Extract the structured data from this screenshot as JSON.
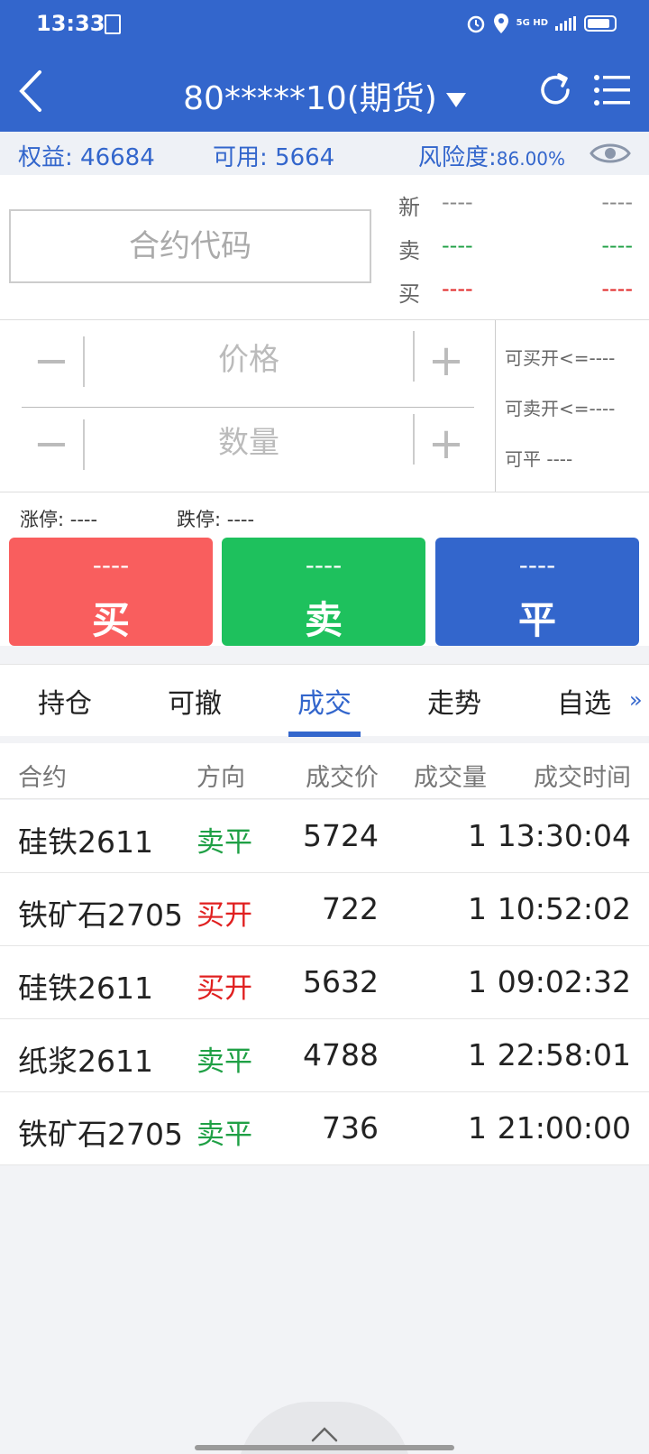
{
  "status_bar": {
    "time": "13:33",
    "network": "5G HD"
  },
  "nav": {
    "account_title": "80*****10(期货)",
    "back_icon": "chevron-left-icon",
    "refresh_icon": "refresh-icon",
    "menu_icon": "menu-list-icon"
  },
  "account": {
    "equity_label": "权益:",
    "equity_value": "46684",
    "available_label": "可用:",
    "available_value": "5664",
    "risk_label": "风险度:",
    "risk_value": "86.00%"
  },
  "quote": {
    "code_placeholder": "合约代码",
    "rows": [
      {
        "label": "新",
        "v1": "----",
        "v2": "----"
      },
      {
        "label": "卖",
        "v1": "----",
        "v2": "----"
      },
      {
        "label": "买",
        "v1": "----",
        "v2": "----"
      }
    ]
  },
  "order": {
    "minus": "−",
    "plus": "+",
    "price_placeholder": "价格",
    "qty_placeholder": "数量",
    "can_buy_open": "可买开<=----",
    "can_sell_open": "可卖开<=----",
    "can_close": "可平  ----"
  },
  "limits": {
    "up": "涨停: ----",
    "down": "跌停: ----"
  },
  "actions": [
    {
      "price": "----",
      "label": "买"
    },
    {
      "price": "----",
      "label": "卖"
    },
    {
      "price": "----",
      "label": "平"
    }
  ],
  "tabs": [
    "持仓",
    "可撤",
    "成交",
    "走势",
    "自选"
  ],
  "tab_more": "»",
  "table": {
    "headers": [
      "合约",
      "方向",
      "成交价",
      "成交量",
      "成交时间"
    ],
    "rows": [
      {
        "contract": "硅铁2611",
        "direction": "卖平",
        "price": "5724",
        "qty": "1",
        "time": "13:30:04"
      },
      {
        "contract": "铁矿石2705",
        "direction": "买开",
        "price": "722",
        "qty": "1",
        "time": "10:52:02"
      },
      {
        "contract": "硅铁2611",
        "direction": "买开",
        "price": "5632",
        "qty": "1",
        "time": "09:02:32"
      },
      {
        "contract": "纸浆2611",
        "direction": "卖平",
        "price": "4788",
        "qty": "1",
        "time": "22:58:01"
      },
      {
        "contract": "铁矿石2705",
        "direction": "卖平",
        "price": "736",
        "qty": "1",
        "time": "21:00:00"
      }
    ]
  },
  "colors": {
    "primary": "#3366cc",
    "buy": "#f95e5e",
    "sell": "#1ec15d",
    "up_text": "#e02020",
    "down_text": "#1fa045"
  }
}
